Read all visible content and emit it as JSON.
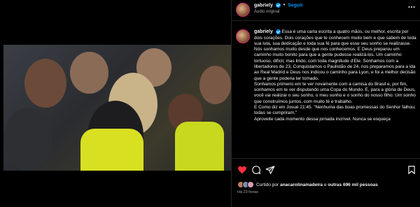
{
  "post": {
    "username": "gabriely",
    "follow_label": "Seguir",
    "audio_label": "Áudio original",
    "separator": "•"
  },
  "caption": {
    "username": "gabriely",
    "text": "Essa é uma carta escrita a quatro mãos, ou melhor, escrita por dois corações. Dois corações que te conhecem muito bem e que sabem de toda sua luta, sua dedicação e toda sua fé para que esse seu sonho se realizasse.\nNós sonhamos muito desde que nos conhecemos. E Deus preparou um caminho muito bonito para que a gente pudesse realizá-los. Um caminho tortuoso, difícil, mas lindo, com toda magnitude d'Ele. Sonhamos com a libertadores de 23, Conquistamos o Paulistão de 24, nos preparamos para a ida ao Real Madrid e Deus nos indicou o caminho para Lyon, e foi a melhor decisão que a gente poderia ter tomado.\nSonhamos primeiro em te ver novamente com a camisa do Brasil e, por fim, sonhamos em te ver disputando uma Copa do Mundo. E, para a glória de Deus, você vai realizar o seu sonho, o meu sonho e o sonho do nosso filho. Um sonho que construímos juntos, com muito fé e trabalho.\nE Como diz em Josué 21:45. \"Nenhuma das boas promessas do Senhor falhou; todas se cumpriram.\"\nAproveite cada momento dessa jornada incrível. Nunca se esqueça"
  },
  "likes": {
    "prefix": "Curtido por",
    "user": "anacarolinamadeira",
    "connector": "e",
    "others": "outras 696 mil pessoas"
  },
  "time_ago": "Há 23 horas",
  "colors": {
    "background": "#000000",
    "like_red": "#ff3040",
    "link_blue": "#0095f6",
    "muted_text": "#a8a8a8"
  },
  "icons": [
    "more-icon",
    "heart-icon",
    "comment-icon",
    "share-icon",
    "bookmark-icon",
    "user-tag-icon",
    "mute-icon",
    "verified-icon"
  ]
}
